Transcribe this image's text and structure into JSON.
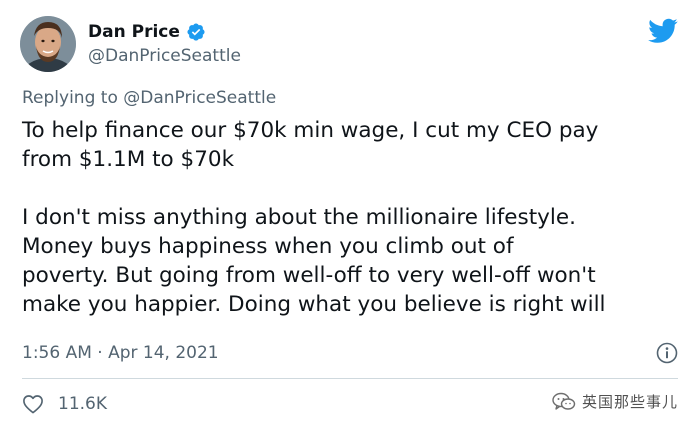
{
  "tweet": {
    "display_name": "Dan Price",
    "handle": "@DanPriceSeattle",
    "replying_prefix": "Replying to",
    "replying_handle": "@DanPriceSeattle",
    "text_lines": [
      "To help finance our $70k min wage, I cut my CEO pay",
      "from $1.1M to $70k",
      "",
      "I don't miss anything about the millionaire lifestyle.",
      "Money buys happiness when you climb out of",
      "poverty. But going from well-off to very well-off won't",
      "make you happier. Doing what you believe is right will"
    ],
    "timestamp": "1:56 AM · Apr 14, 2021",
    "likes": "11.6K"
  },
  "watermark": {
    "text": "英国那些事儿"
  },
  "colors": {
    "twitter_blue": "#1d9bf0",
    "text_primary": "#0f1419",
    "text_secondary": "#536471",
    "divider": "#cfd9de"
  },
  "icons": {
    "verified": "verified-badge-icon",
    "bird": "twitter-bird-icon",
    "info": "info-icon",
    "heart": "heart-icon",
    "watermark": "wechat-icon"
  }
}
